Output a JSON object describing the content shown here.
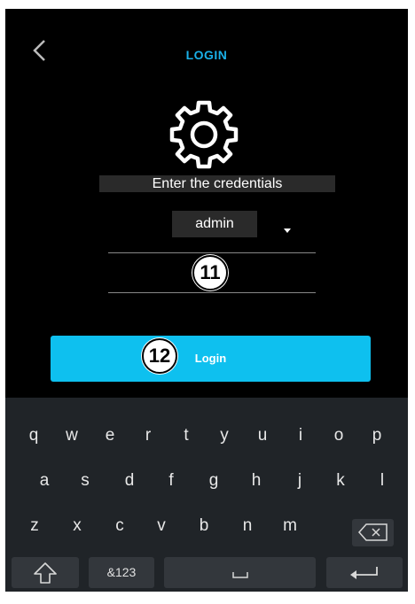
{
  "header": {
    "title": "LOGIN",
    "back_icon": "chevron-left-icon"
  },
  "form": {
    "icon": "gear-icon",
    "prompt": "Enter the credentials",
    "username": "admin",
    "password_value": ""
  },
  "annotations": {
    "badge_password": "11",
    "badge_login": "12"
  },
  "login_button": {
    "label": "Login"
  },
  "keyboard": {
    "row1": [
      "q",
      "w",
      "e",
      "r",
      "t",
      "y",
      "u",
      "i",
      "o",
      "p"
    ],
    "row2": [
      "a",
      "s",
      "d",
      "f",
      "g",
      "h",
      "j",
      "k",
      "l"
    ],
    "row3": [
      "z",
      "x",
      "c",
      "v",
      "b",
      "n",
      "m"
    ],
    "symbols_label": "&123",
    "backspace_icon": "backspace-icon",
    "shift_icon": "shift-icon",
    "space_icon": "space-icon",
    "enter_icon": "enter-icon"
  },
  "colors": {
    "accent": "#1ab0e8",
    "button": "#0ec0ef",
    "background": "#000000",
    "keyboard_bg": "#202428"
  }
}
